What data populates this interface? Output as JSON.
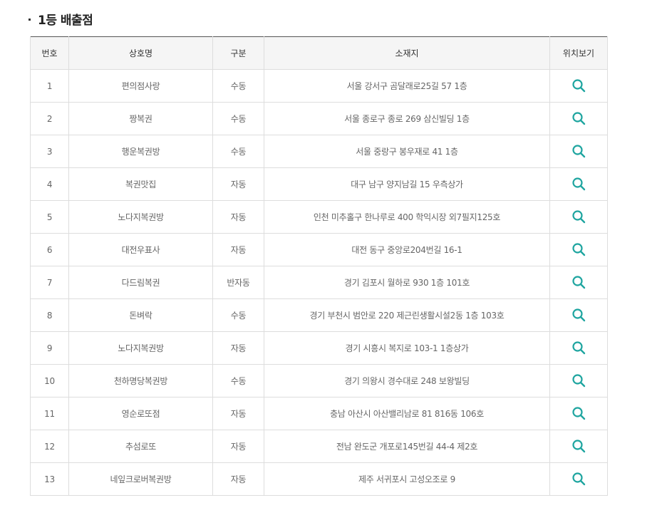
{
  "section": {
    "title": "1등 배출점"
  },
  "table": {
    "headers": {
      "no": "번호",
      "name": "상호명",
      "type": "구분",
      "address": "소재지",
      "location": "위치보기"
    },
    "rows": [
      {
        "no": "1",
        "name": "편의점사랑",
        "type": "수동",
        "address": "서울 강서구 곰달래로25길 57 1층"
      },
      {
        "no": "2",
        "name": "짱복권",
        "type": "수동",
        "address": "서울 종로구 종로 269 삼신빌딩 1층"
      },
      {
        "no": "3",
        "name": "행운복권방",
        "type": "수동",
        "address": "서울 중랑구 봉우재로 41 1층"
      },
      {
        "no": "4",
        "name": "복권맛집",
        "type": "자동",
        "address": "대구 남구 양지남길 15 우측상가"
      },
      {
        "no": "5",
        "name": "노다지복권방",
        "type": "자동",
        "address": "인천 미추홀구 한나루로 400 학익시장 외7필지125호"
      },
      {
        "no": "6",
        "name": "대전우표사",
        "type": "자동",
        "address": "대전 동구 중앙로204번길 16-1"
      },
      {
        "no": "7",
        "name": "다드림복권",
        "type": "반자동",
        "address": "경기 김포시 월하로 930 1층 101호"
      },
      {
        "no": "8",
        "name": "돈벼락",
        "type": "수동",
        "address": "경기 부천시 범안로 220 제근린생활시설2동 1층 103호"
      },
      {
        "no": "9",
        "name": "노다지복권방",
        "type": "자동",
        "address": "경기 시흥시 복지로 103-1 1층상가"
      },
      {
        "no": "10",
        "name": "천하명당복권방",
        "type": "수동",
        "address": "경기 의왕시 경수대로 248 보왕빌딩"
      },
      {
        "no": "11",
        "name": "영순로또점",
        "type": "자동",
        "address": "충남 아산시 아산밸리남로 81 816동 106호"
      },
      {
        "no": "12",
        "name": "추섬로또",
        "type": "자동",
        "address": "전남 완도군 개포로145번길 44-4 제2호"
      },
      {
        "no": "13",
        "name": "네잎크로버복권방",
        "type": "자동",
        "address": "제주 서귀포시 고성오조로 9"
      }
    ]
  },
  "icons": {
    "location": "search-icon"
  },
  "colors": {
    "accent": "#1fa5a0",
    "header_bg": "#f5f5f5",
    "border": "#dddddd"
  }
}
